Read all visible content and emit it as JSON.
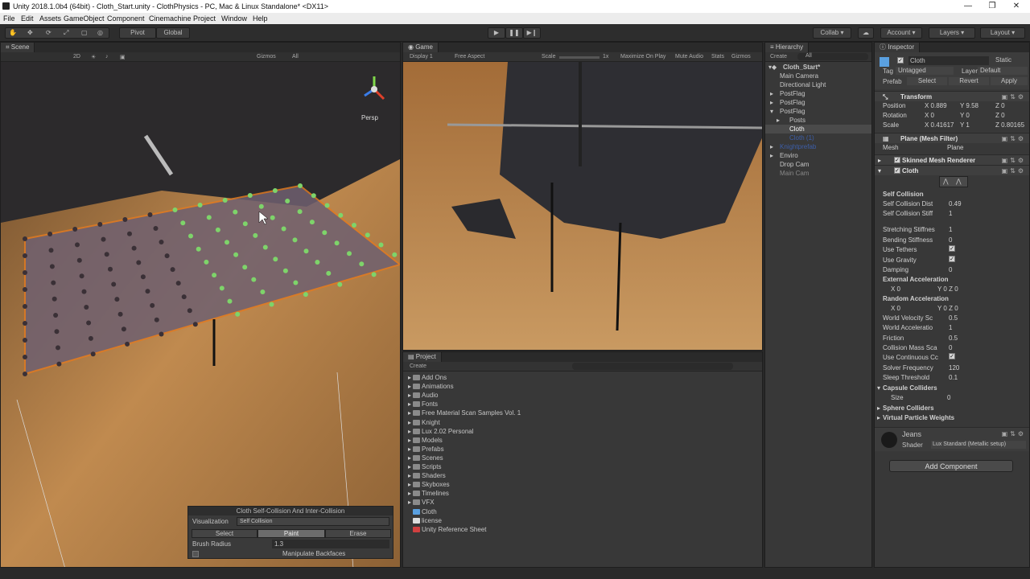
{
  "window": {
    "title": "Unity 2018.1.0b4 (64bit) - Cloth_Start.unity - ClothPhysics - PC, Mac & Linux Standalone* <DX11>",
    "minimize": "—",
    "restore": "❐",
    "close": "✕"
  },
  "menu": [
    "File",
    "Edit",
    "Assets",
    "GameObject",
    "Component",
    "Cinemachine",
    "Project",
    "Window",
    "Help"
  ],
  "toolbar": {
    "pivot": "Pivot",
    "global": "Global",
    "collab": "Collab",
    "account": "Account",
    "layers": "Layers",
    "layout": "Layout"
  },
  "scene": {
    "tab": "Scene",
    "mode_2d": "2D",
    "gizmos": "Gizmos",
    "search_all": "All",
    "persp": "Persp"
  },
  "cloth_tool": {
    "title": "Cloth Self-Collision And Inter-Collision",
    "visualization_label": "Visualization",
    "visualization_value": "Self Collision",
    "select": "Select",
    "paint": "Paint",
    "erase": "Erase",
    "brush_radius_label": "Brush Radius",
    "brush_radius_value": "1.3",
    "manipulate_backfaces": "Manipulate Backfaces"
  },
  "game": {
    "tab": "Game",
    "display": "Display 1",
    "aspect": "Free Aspect",
    "scale_label": "Scale",
    "scale_value": "1x",
    "maximize": "Maximize On Play",
    "mute": "Mute Audio",
    "stats": "Stats",
    "gizmos": "Gizmos"
  },
  "hierarchy": {
    "tab": "Hierarchy",
    "create": "Create",
    "search": "All",
    "scene": "Cloth_Start*",
    "items": [
      {
        "label": "Main Camera"
      },
      {
        "label": "Directional Light"
      },
      {
        "label": "PostFlag"
      },
      {
        "label": "PostFlag"
      },
      {
        "label": "PostFlag"
      },
      {
        "label": "Posts"
      },
      {
        "label": "Cloth"
      },
      {
        "label": "Cloth (1)"
      },
      {
        "label": "Knightprefab"
      },
      {
        "label": "Enviro"
      },
      {
        "label": "Drop Cam"
      },
      {
        "label": "Main Cam"
      }
    ]
  },
  "project": {
    "tab": "Project",
    "create": "Create",
    "items": [
      {
        "label": "Add Ons"
      },
      {
        "label": "Animations"
      },
      {
        "label": "Audio"
      },
      {
        "label": "Fonts"
      },
      {
        "label": "Free Material Scan Samples Vol. 1"
      },
      {
        "label": "Knight"
      },
      {
        "label": "Lux 2.02 Personal"
      },
      {
        "label": "Models"
      },
      {
        "label": "Prefabs"
      },
      {
        "label": "Scenes"
      },
      {
        "label": "Scripts"
      },
      {
        "label": "Shaders"
      },
      {
        "label": "Skyboxes"
      },
      {
        "label": "Timelines"
      },
      {
        "label": "VFX"
      },
      {
        "label": "Cloth"
      },
      {
        "label": "license"
      },
      {
        "label": "Unity Reference Sheet"
      }
    ]
  },
  "inspector": {
    "tab": "Inspector",
    "object_name": "Cloth",
    "static": "Static",
    "tag_label": "Tag",
    "tag_value": "Untagged",
    "layer_label": "Layer",
    "layer_value": "Default",
    "prefab_label": "Prefab",
    "prefab_select": "Select",
    "prefab_revert": "Revert",
    "prefab_apply": "Apply",
    "transform": "Transform",
    "position_label": "Position",
    "pos_x": "X 0.889",
    "pos_y": "Y 9.58",
    "pos_z": "Z 0",
    "rotation_label": "Rotation",
    "rot_x": "X 0",
    "rot_y": "Y 0",
    "rot_z": "Z 0",
    "scale_label": "Scale",
    "scl_x": "X 0.41617",
    "scl_y": "Y 1",
    "scl_z": "Z 0.80165",
    "mesh_filter": "Plane (Mesh Filter)",
    "mesh_label": "Mesh",
    "mesh_value": "Plane",
    "skinned_renderer": "Skinned Mesh Renderer",
    "cloth": "Cloth",
    "props": [
      {
        "label": "Self Collision",
        "value": ""
      },
      {
        "label": "Self Collision Dist",
        "value": "0.49"
      },
      {
        "label": "Self Collision Stiff",
        "value": "1"
      },
      {
        "label": "Stretching Stiffnes",
        "value": "1"
      },
      {
        "label": "Bending Stiffness",
        "value": "0"
      },
      {
        "label": "Use Tethers",
        "value": "✓"
      },
      {
        "label": "Use Gravity",
        "value": "✓"
      },
      {
        "label": "Damping",
        "value": "0"
      },
      {
        "label": "External Acceleration",
        "value": ""
      },
      {
        "label": "X 0",
        "value": "Y 0          Z 0"
      },
      {
        "label": "Random Acceleration",
        "value": ""
      },
      {
        "label": "X 0",
        "value": "Y 0          Z 0"
      },
      {
        "label": "World Velocity Sc",
        "value": "0.5"
      },
      {
        "label": "World Acceleratio",
        "value": "1"
      },
      {
        "label": "Friction",
        "value": "0.5"
      },
      {
        "label": "Collision Mass Sca",
        "value": "0"
      },
      {
        "label": "Use Continuous Cc",
        "value": "✓"
      },
      {
        "label": "Solver Frequency",
        "value": "120"
      },
      {
        "label": "Sleep Threshold",
        "value": "0.1"
      }
    ],
    "capsule_colliders": "Capsule Colliders",
    "size_label": "Size",
    "size_value": "0",
    "sphere_colliders": "Sphere Colliders",
    "virtual_weights": "Virtual Particle Weights",
    "material_name": "Jeans",
    "shader_label": "Shader",
    "shader_value": "Lux Standard (Metallic setup)",
    "add_component": "Add Component"
  }
}
